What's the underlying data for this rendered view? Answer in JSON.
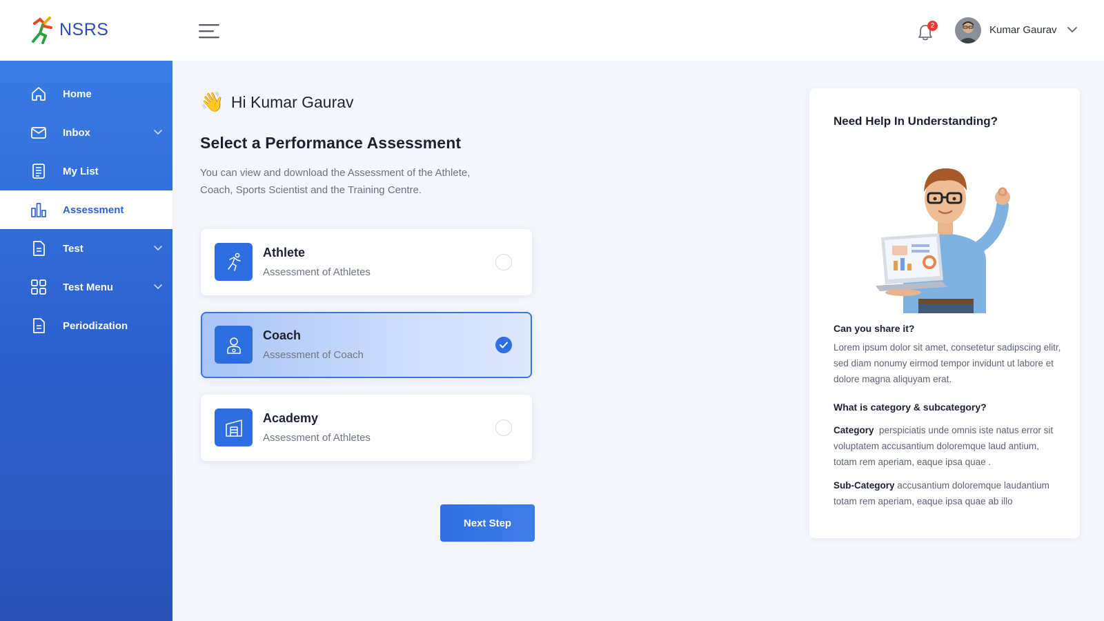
{
  "app": {
    "logo_text": "NSRS"
  },
  "header": {
    "notification_count": "2",
    "user_name": "Kumar Gaurav"
  },
  "sidebar": {
    "items": [
      {
        "label": "Home",
        "icon": "home-icon",
        "has_children": false,
        "active": false
      },
      {
        "label": "Inbox",
        "icon": "mail-icon",
        "has_children": true,
        "active": false
      },
      {
        "label": "My List",
        "icon": "list-icon",
        "has_children": false,
        "active": false
      },
      {
        "label": "Assessment",
        "icon": "bar-chart-icon",
        "has_children": false,
        "active": true
      },
      {
        "label": "Test",
        "icon": "document-icon",
        "has_children": true,
        "active": false
      },
      {
        "label": "Test Menu",
        "icon": "grid-icon",
        "has_children": true,
        "active": false
      },
      {
        "label": "Periodization",
        "icon": "document-icon",
        "has_children": false,
        "active": false
      }
    ]
  },
  "main": {
    "greeting": "Hi Kumar Gaurav",
    "title": "Select a Performance Assessment",
    "description": "You can view and download the Assessment of the Athlete, Coach, Sports Scientist and the Training Centre.",
    "options": [
      {
        "title": "Athlete",
        "subtitle": "Assessment of Athletes",
        "icon": "running-icon",
        "selected": false
      },
      {
        "title": "Coach",
        "subtitle": "Assessment of Coach",
        "icon": "coach-icon",
        "selected": true
      },
      {
        "title": "Academy",
        "subtitle": "Assessment of Athletes",
        "icon": "building-icon",
        "selected": false
      }
    ],
    "next_button": "Next Step"
  },
  "help": {
    "title": "Need Help In Understanding?",
    "q1": "Can you share it?",
    "a1": "Lorem ipsum dolor sit amet, consetetur sadipscing elitr, sed diam nonumy eirmod tempor invidunt ut labore et dolore magna aliquyam erat.",
    "q2": "What is category & subcategory?",
    "category_label": "Category",
    "category_text": "perspiciatis unde omnis iste natus error sit voluptatem accusantium doloremque laud antium, totam rem aperiam, eaque ipsa quae .",
    "subcategory_label": "Sub-Category",
    "subcategory_text": "accusantium doloremque laudantium totam rem aperiam, eaque ipsa quae ab illo"
  },
  "colors": {
    "primary": "#2f6ee0",
    "sidebar_top": "#3a7be4",
    "sidebar_bottom": "#2a52b8",
    "badge": "#e53935"
  }
}
